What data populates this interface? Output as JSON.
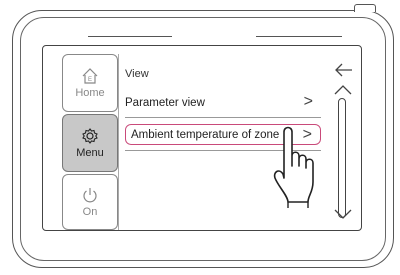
{
  "sidebar": {
    "items": [
      {
        "label": "Home",
        "icon": "home-icon"
      },
      {
        "label": "Menu",
        "icon": "settings-gear-icon",
        "active": true
      },
      {
        "label": "On",
        "icon": "power-icon"
      }
    ]
  },
  "main": {
    "title": "View",
    "rows": [
      {
        "label": "Parameter view",
        "chevron": ">"
      },
      {
        "label": "Ambient temperature of zone",
        "chevron": ">",
        "selected": true
      }
    ]
  },
  "colors": {
    "highlight": "#c94a7a",
    "active_tab": "#c8c8c8"
  },
  "icons": [
    "back-arrow-icon",
    "scroll-up-icon",
    "scroll-down-icon",
    "tap-hand-icon"
  ]
}
